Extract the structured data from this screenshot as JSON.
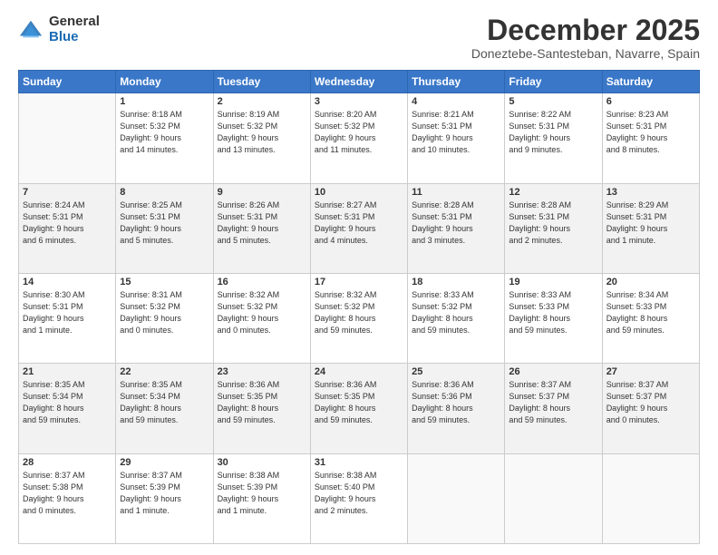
{
  "logo": {
    "general": "General",
    "blue": "Blue"
  },
  "header": {
    "month": "December 2025",
    "location": "Doneztebe-Santesteban, Navarre, Spain"
  },
  "weekdays": [
    "Sunday",
    "Monday",
    "Tuesday",
    "Wednesday",
    "Thursday",
    "Friday",
    "Saturday"
  ],
  "weeks": [
    [
      {
        "day": "",
        "info": ""
      },
      {
        "day": "1",
        "info": "Sunrise: 8:18 AM\nSunset: 5:32 PM\nDaylight: 9 hours\nand 14 minutes."
      },
      {
        "day": "2",
        "info": "Sunrise: 8:19 AM\nSunset: 5:32 PM\nDaylight: 9 hours\nand 13 minutes."
      },
      {
        "day": "3",
        "info": "Sunrise: 8:20 AM\nSunset: 5:32 PM\nDaylight: 9 hours\nand 11 minutes."
      },
      {
        "day": "4",
        "info": "Sunrise: 8:21 AM\nSunset: 5:31 PM\nDaylight: 9 hours\nand 10 minutes."
      },
      {
        "day": "5",
        "info": "Sunrise: 8:22 AM\nSunset: 5:31 PM\nDaylight: 9 hours\nand 9 minutes."
      },
      {
        "day": "6",
        "info": "Sunrise: 8:23 AM\nSunset: 5:31 PM\nDaylight: 9 hours\nand 8 minutes."
      }
    ],
    [
      {
        "day": "7",
        "info": "Sunrise: 8:24 AM\nSunset: 5:31 PM\nDaylight: 9 hours\nand 6 minutes."
      },
      {
        "day": "8",
        "info": "Sunrise: 8:25 AM\nSunset: 5:31 PM\nDaylight: 9 hours\nand 5 minutes."
      },
      {
        "day": "9",
        "info": "Sunrise: 8:26 AM\nSunset: 5:31 PM\nDaylight: 9 hours\nand 5 minutes."
      },
      {
        "day": "10",
        "info": "Sunrise: 8:27 AM\nSunset: 5:31 PM\nDaylight: 9 hours\nand 4 minutes."
      },
      {
        "day": "11",
        "info": "Sunrise: 8:28 AM\nSunset: 5:31 PM\nDaylight: 9 hours\nand 3 minutes."
      },
      {
        "day": "12",
        "info": "Sunrise: 8:28 AM\nSunset: 5:31 PM\nDaylight: 9 hours\nand 2 minutes."
      },
      {
        "day": "13",
        "info": "Sunrise: 8:29 AM\nSunset: 5:31 PM\nDaylight: 9 hours\nand 1 minute."
      }
    ],
    [
      {
        "day": "14",
        "info": "Sunrise: 8:30 AM\nSunset: 5:31 PM\nDaylight: 9 hours\nand 1 minute."
      },
      {
        "day": "15",
        "info": "Sunrise: 8:31 AM\nSunset: 5:32 PM\nDaylight: 9 hours\nand 0 minutes."
      },
      {
        "day": "16",
        "info": "Sunrise: 8:32 AM\nSunset: 5:32 PM\nDaylight: 9 hours\nand 0 minutes."
      },
      {
        "day": "17",
        "info": "Sunrise: 8:32 AM\nSunset: 5:32 PM\nDaylight: 8 hours\nand 59 minutes."
      },
      {
        "day": "18",
        "info": "Sunrise: 8:33 AM\nSunset: 5:32 PM\nDaylight: 8 hours\nand 59 minutes."
      },
      {
        "day": "19",
        "info": "Sunrise: 8:33 AM\nSunset: 5:33 PM\nDaylight: 8 hours\nand 59 minutes."
      },
      {
        "day": "20",
        "info": "Sunrise: 8:34 AM\nSunset: 5:33 PM\nDaylight: 8 hours\nand 59 minutes."
      }
    ],
    [
      {
        "day": "21",
        "info": "Sunrise: 8:35 AM\nSunset: 5:34 PM\nDaylight: 8 hours\nand 59 minutes."
      },
      {
        "day": "22",
        "info": "Sunrise: 8:35 AM\nSunset: 5:34 PM\nDaylight: 8 hours\nand 59 minutes."
      },
      {
        "day": "23",
        "info": "Sunrise: 8:36 AM\nSunset: 5:35 PM\nDaylight: 8 hours\nand 59 minutes."
      },
      {
        "day": "24",
        "info": "Sunrise: 8:36 AM\nSunset: 5:35 PM\nDaylight: 8 hours\nand 59 minutes."
      },
      {
        "day": "25",
        "info": "Sunrise: 8:36 AM\nSunset: 5:36 PM\nDaylight: 8 hours\nand 59 minutes."
      },
      {
        "day": "26",
        "info": "Sunrise: 8:37 AM\nSunset: 5:37 PM\nDaylight: 8 hours\nand 59 minutes."
      },
      {
        "day": "27",
        "info": "Sunrise: 8:37 AM\nSunset: 5:37 PM\nDaylight: 9 hours\nand 0 minutes."
      }
    ],
    [
      {
        "day": "28",
        "info": "Sunrise: 8:37 AM\nSunset: 5:38 PM\nDaylight: 9 hours\nand 0 minutes."
      },
      {
        "day": "29",
        "info": "Sunrise: 8:37 AM\nSunset: 5:39 PM\nDaylight: 9 hours\nand 1 minute."
      },
      {
        "day": "30",
        "info": "Sunrise: 8:38 AM\nSunset: 5:39 PM\nDaylight: 9 hours\nand 1 minute."
      },
      {
        "day": "31",
        "info": "Sunrise: 8:38 AM\nSunset: 5:40 PM\nDaylight: 9 hours\nand 2 minutes."
      },
      {
        "day": "",
        "info": ""
      },
      {
        "day": "",
        "info": ""
      },
      {
        "day": "",
        "info": ""
      }
    ]
  ]
}
